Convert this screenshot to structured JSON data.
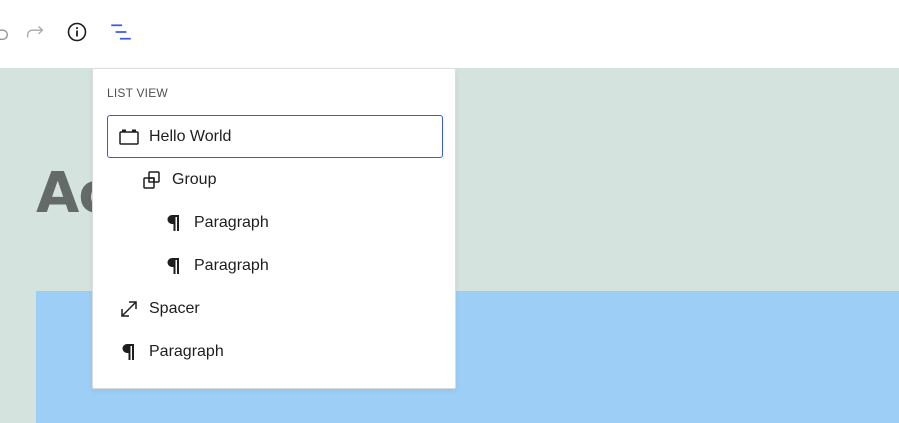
{
  "toolbar": {
    "undo_icon": "undo-icon",
    "redo_icon": "redo-icon",
    "info_icon": "info-icon",
    "list_view_icon": "list-view-icon",
    "accent_color": "#3858e9"
  },
  "canvas": {
    "heading_partial": "Ac",
    "background_color": "#d4e3de",
    "block_color": "#9dcef5"
  },
  "list_view": {
    "title": "LIST VIEW",
    "items": [
      {
        "label": "Hello World",
        "icon": "group-container-icon",
        "level": 1,
        "selected": true
      },
      {
        "label": "Group",
        "icon": "group-icon",
        "level": 2,
        "selected": false
      },
      {
        "label": "Paragraph",
        "icon": "paragraph-icon",
        "level": 3,
        "selected": false
      },
      {
        "label": "Paragraph",
        "icon": "paragraph-icon",
        "level": 3,
        "selected": false
      },
      {
        "label": "Spacer",
        "icon": "spacer-resize-icon",
        "level": 1,
        "selected": false
      },
      {
        "label": "Paragraph",
        "icon": "paragraph-icon",
        "level": 1,
        "selected": false
      }
    ]
  }
}
